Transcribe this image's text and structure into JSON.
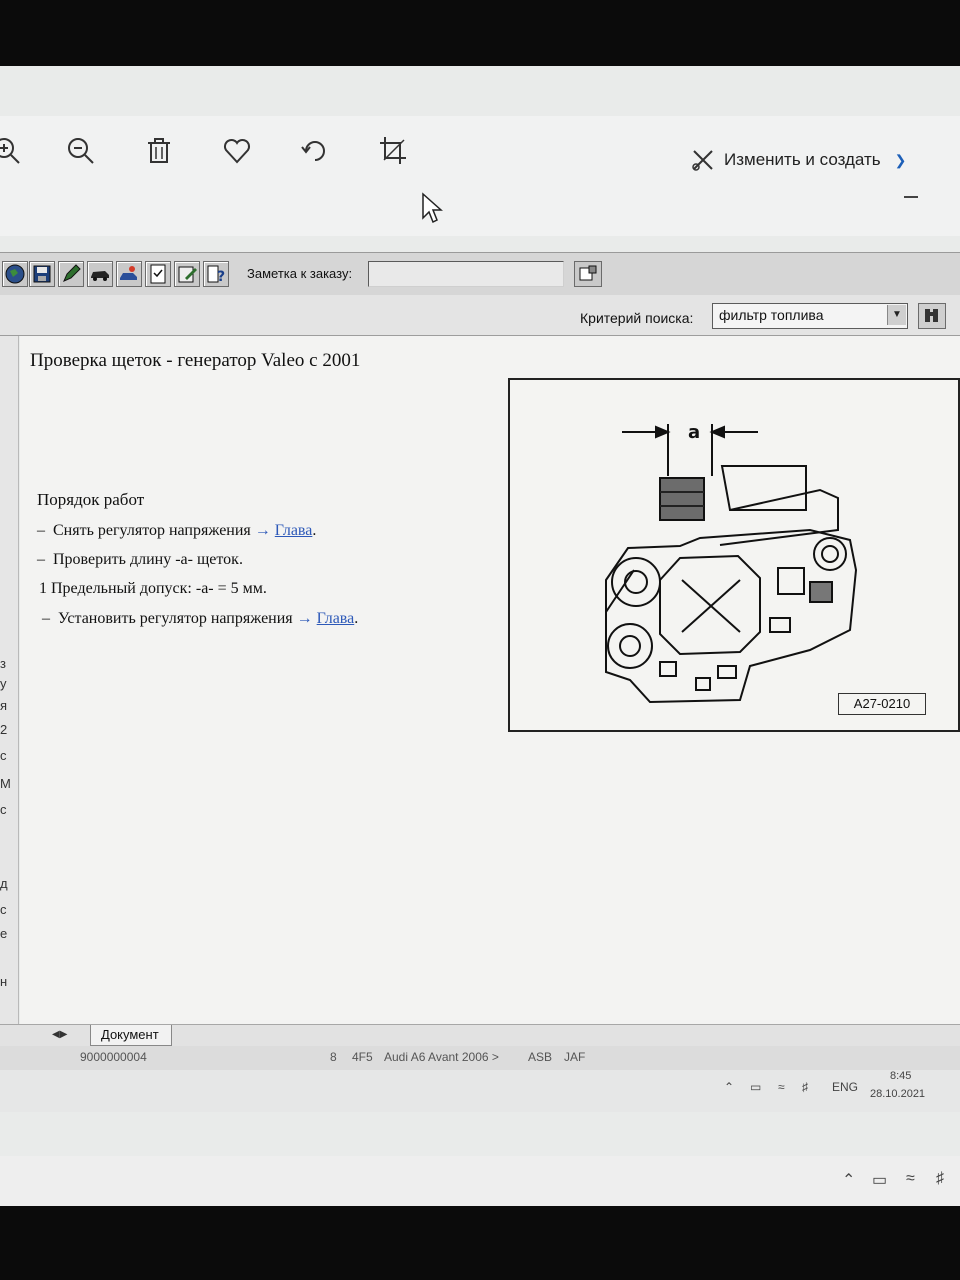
{
  "viewer": {
    "toolbar_icons": [
      "zoom-in-icon",
      "zoom-out-icon",
      "delete-icon",
      "heart-icon",
      "rotate-icon",
      "crop-icon"
    ],
    "edit_create_label": "Изменить и создать"
  },
  "app": {
    "toolbar_icons": [
      "globe-icon",
      "save-icon",
      "pen-icon",
      "car-icon",
      "service-icon",
      "checklist-icon",
      "notes-icon",
      "help-icon"
    ],
    "note_label": "Заметка к заказу:",
    "note_value": "",
    "search_label": "Критерий поиска:",
    "search_value": "фильтр топлива"
  },
  "document": {
    "title": "Проверка щеток - генератор Valeo с 2001",
    "work_heading": "Порядок работ",
    "steps": [
      {
        "prefix": "–",
        "text": "Снять регулятор напряжения ",
        "arrow": "→",
        "link": "Глава",
        "suffix": "."
      },
      {
        "prefix": "–",
        "text": "Проверить длину -a- щеток."
      },
      {
        "prefix": "1",
        "text": "Предельный допуск: -a- = 5 мм."
      },
      {
        "prefix": "–",
        "text": "Установить регулятор напряжения ",
        "arrow": "→",
        "link": "Глава",
        "suffix": "."
      }
    ],
    "figure": {
      "dimension_label": "a",
      "id": "A27-0210"
    }
  },
  "tabs": {
    "active": "Документ"
  },
  "status": {
    "order": "9000000004",
    "items": [
      "8",
      "4F5",
      "Audi A6 Avant 2006 >",
      "ASB",
      "JAF"
    ]
  },
  "taskbar": {
    "lang": "ENG",
    "time": "8:45",
    "date": "28.10.2021"
  }
}
